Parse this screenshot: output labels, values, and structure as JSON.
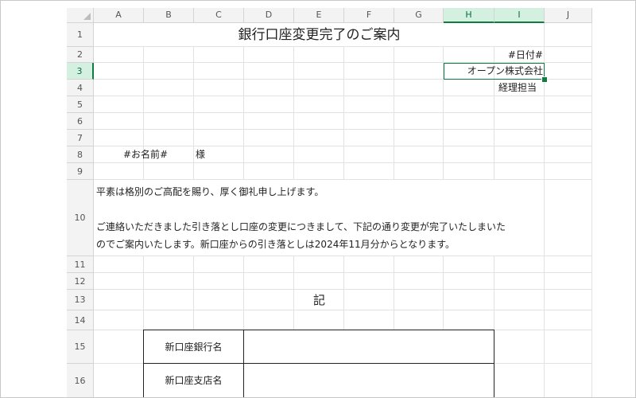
{
  "columns": [
    "A",
    "B",
    "C",
    "D",
    "E",
    "F",
    "G",
    "H",
    "I",
    "J"
  ],
  "rows": [
    "1",
    "2",
    "3",
    "4",
    "5",
    "6",
    "7",
    "8",
    "9",
    "10",
    "11",
    "12",
    "13",
    "14",
    "15",
    "16"
  ],
  "selected_cell": "H3",
  "document": {
    "title": "銀行口座変更完了のご案内",
    "date_placeholder": "#日付#",
    "company": "オープン株式会社",
    "department": "経理担当",
    "name_placeholder": "#お名前#",
    "honorific": "様",
    "paragraph_line1": "平素は格別のご高配を賜り、厚く御礼申し上げます。",
    "paragraph_line2": "ご連絡いただきました引き落とし口座の変更につきまして、下記の通り変更が完了いたしまいた",
    "paragraph_line3": "のでご案内いたします。新口座からの引き落としは2024年11月分からとなります。",
    "ki": "記",
    "table_labels": [
      "新口座銀行名",
      "新口座支店名"
    ]
  }
}
